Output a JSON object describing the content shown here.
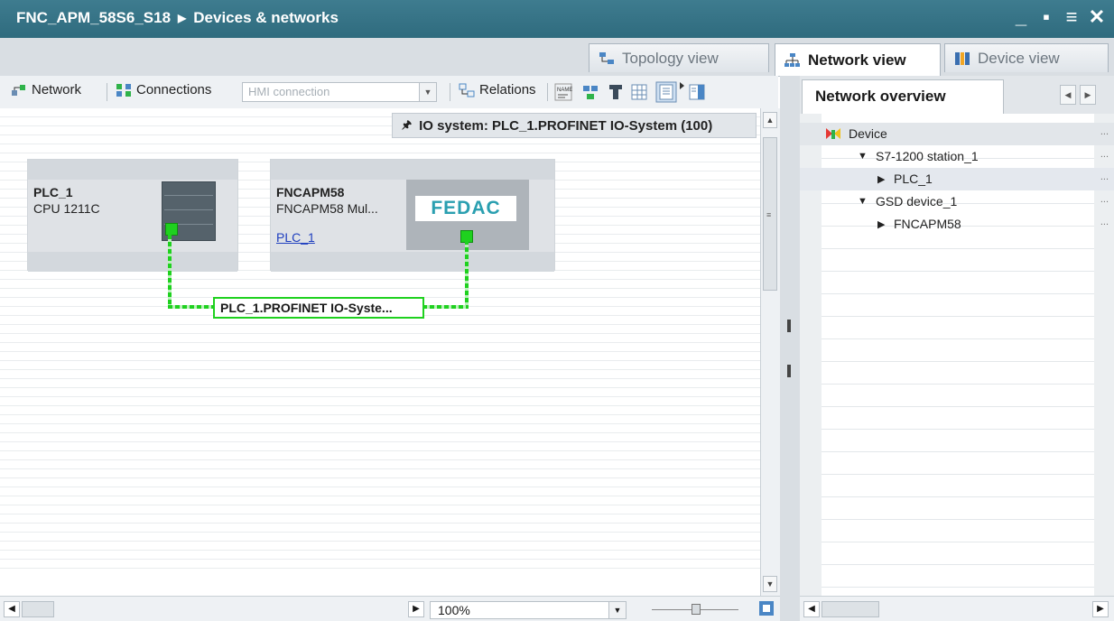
{
  "window": {
    "project": "FNC_APM_58S6_S18",
    "separator": "▶",
    "section": "Devices & networks"
  },
  "view_tabs": {
    "topology": "Topology view",
    "network": "Network view",
    "device": "Device view"
  },
  "toolbar": {
    "network": "Network",
    "connections": "Connections",
    "hmi_placeholder": "HMI connection",
    "relations": "Relations"
  },
  "canvas": {
    "io_system_label": "IO system: PLC_1.PROFINET IO-System (100)",
    "devices": [
      {
        "name": "PLC_1",
        "type": "CPU 1211C"
      },
      {
        "name": "FNCAPM58",
        "type": "FNCAPM58 Mul...",
        "assigned_to": "PLC_1",
        "logo": "FEDAC"
      }
    ],
    "network_label": "PLC_1.PROFINET IO-Syste...",
    "zoom": "100%"
  },
  "overview": {
    "tab": "Network overview",
    "header": "Device",
    "rows": [
      {
        "label": "S7-1200 station_1",
        "expander": "▼"
      },
      {
        "label": "PLC_1",
        "expander": "▶"
      },
      {
        "label": "GSD device_1",
        "expander": "▼"
      },
      {
        "label": "FNCAPM58",
        "expander": "▶"
      }
    ],
    "more": "..."
  },
  "colors": {
    "titlebar": "#2f6b7e",
    "network_line": "#1fd11f",
    "link": "#1f3fbf"
  }
}
